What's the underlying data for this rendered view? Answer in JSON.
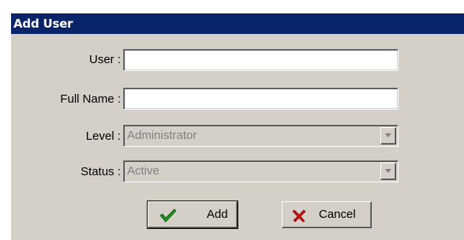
{
  "dialog": {
    "title": "Add User"
  },
  "form": {
    "user_label": "User :",
    "user_value": "",
    "fullname_label": "Full Name :",
    "fullname_value": "",
    "level_label": "Level :",
    "level_value": "Administrator",
    "status_label": "Status :",
    "status_value": "Active"
  },
  "buttons": {
    "add_label": "Add",
    "add_icon": "checkmark-icon",
    "cancel_label": "Cancel",
    "cancel_icon": "x-icon"
  },
  "colors": {
    "titlebar": "#0a246a",
    "dialog_bg": "#d4d0c8",
    "check_green": "#1f8f1f",
    "cancel_red": "#cc1010"
  }
}
